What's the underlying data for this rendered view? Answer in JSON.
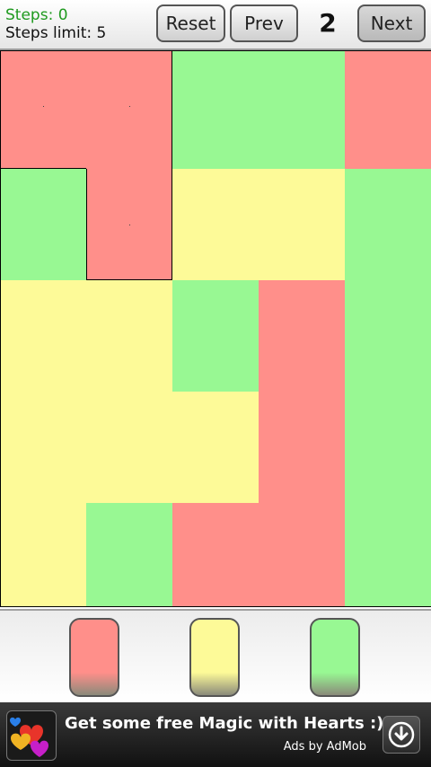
{
  "header": {
    "steps_text": "Steps: 0",
    "steps_limit_text": "Steps limit: 5",
    "reset_label": "Reset",
    "prev_label": "Prev",
    "level_number": "2",
    "next_label": "Next"
  },
  "colors": {
    "red": "#ff8f8a",
    "yellow": "#fdfa98",
    "green": "#98f893"
  },
  "board": {
    "rows": 5,
    "cols": 5,
    "grid": [
      [
        "red",
        "red",
        "green",
        "green",
        "red"
      ],
      [
        "green",
        "red",
        "yellow",
        "yellow",
        "green"
      ],
      [
        "yellow",
        "yellow",
        "green",
        "red",
        "green"
      ],
      [
        "yellow",
        "yellow",
        "yellow",
        "red",
        "green"
      ],
      [
        "yellow",
        "green",
        "red",
        "red",
        "green"
      ]
    ]
  },
  "palette": [
    {
      "color": "red"
    },
    {
      "color": "yellow"
    },
    {
      "color": "green"
    }
  ],
  "ad": {
    "text": "Get some free Magic with Hearts :)",
    "by": "Ads by AdMob",
    "icon": "hearts-icon",
    "action_icon": "download-icon"
  }
}
